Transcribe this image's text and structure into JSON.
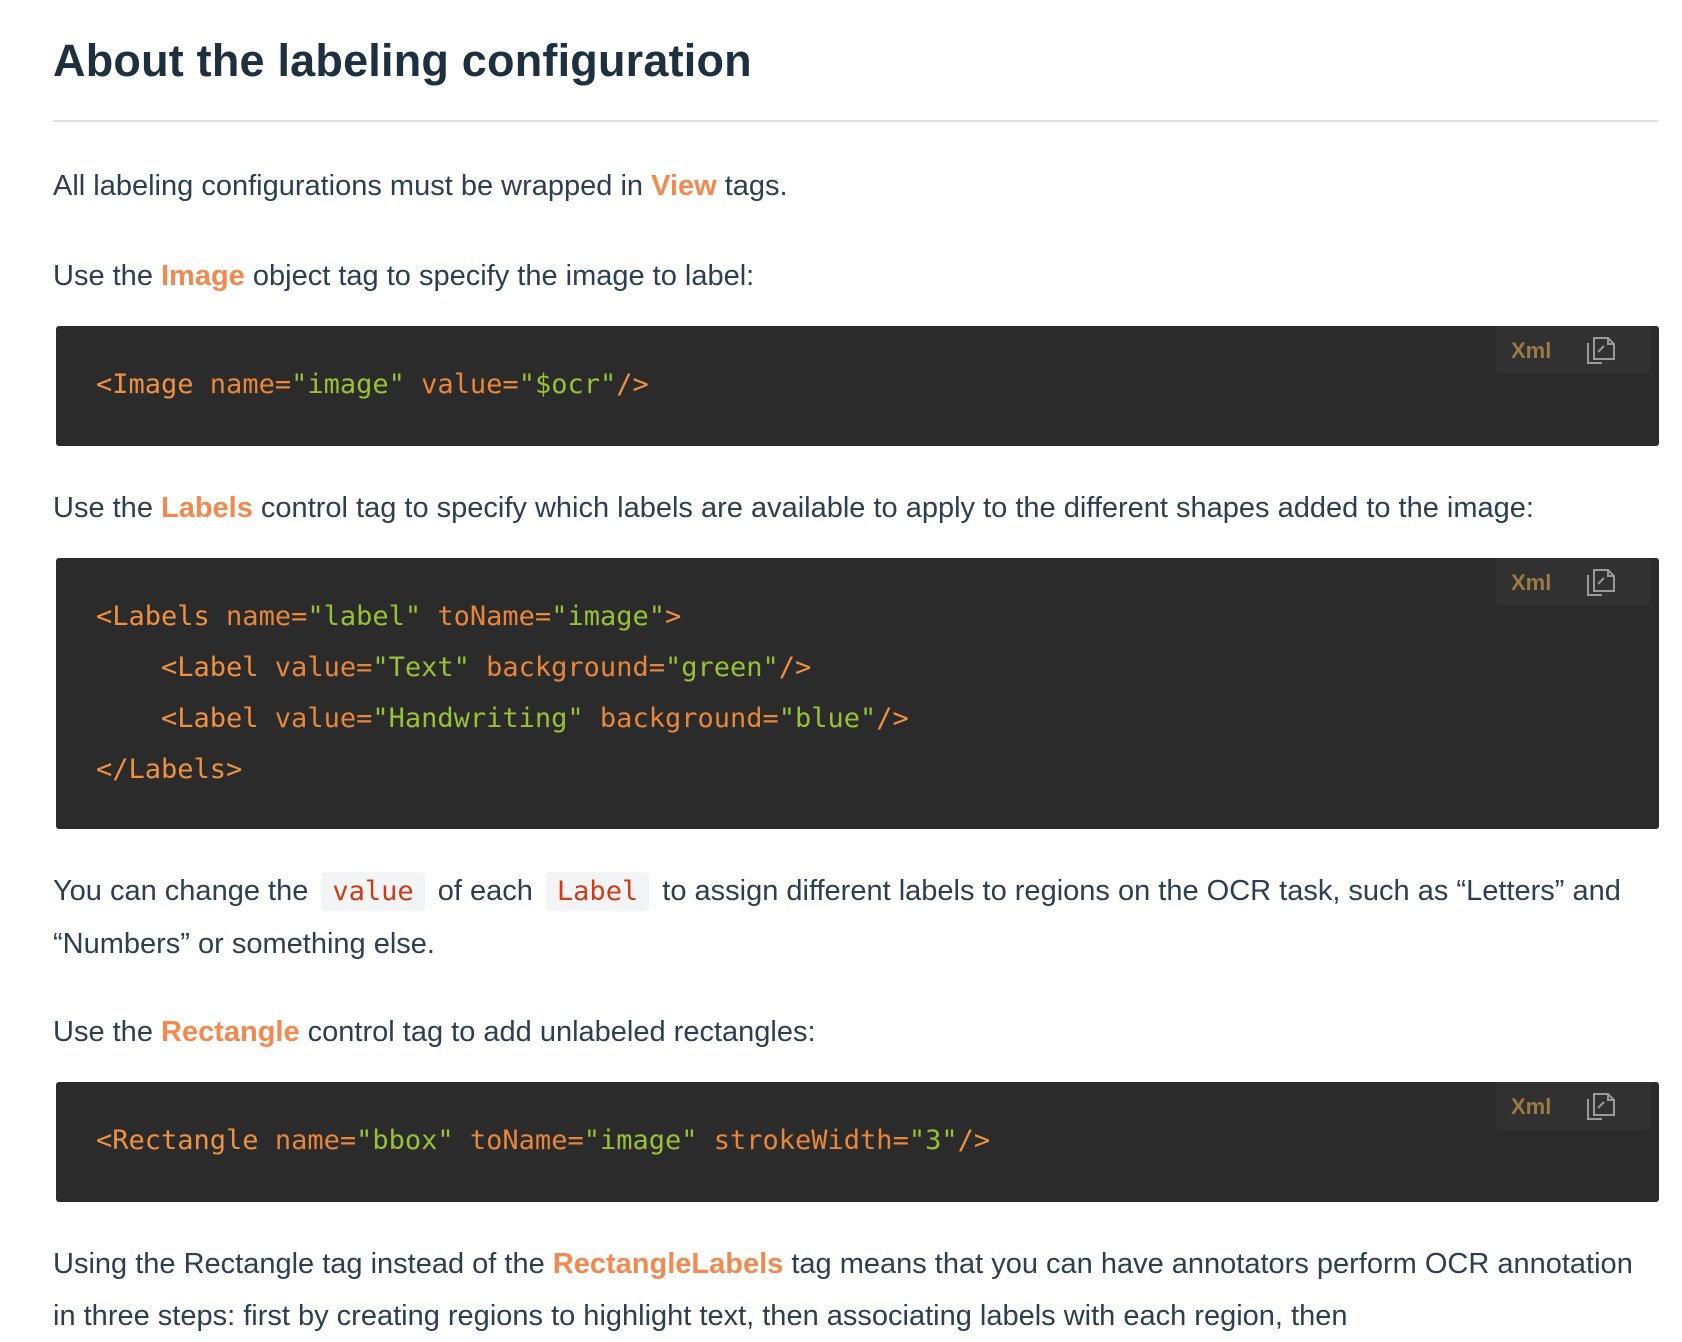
{
  "heading": "About the labeling configuration",
  "para1": {
    "before": "All labeling configurations must be wrapped in ",
    "tag": "View",
    "after": " tags."
  },
  "para2": {
    "before": "Use the ",
    "tag": "Image",
    "after": " object tag to specify the image to label:"
  },
  "code_lang": "Xml",
  "code1": {
    "l1": {
      "open": "<Image",
      "attr1": " name=",
      "val1": "\"image\"",
      "attr2": " value=",
      "val2": "\"$ocr\"",
      "close": "/>"
    }
  },
  "para3": {
    "before": "Use the ",
    "tag": "Labels",
    "after": " control tag to specify which labels are available to apply to the different shapes added to the image:"
  },
  "code2": {
    "l1": {
      "open": "<Labels",
      "attr1": " name=",
      "val1": "\"label\"",
      "attr2": " toName=",
      "val2": "\"image\"",
      "close": ">"
    },
    "l2": {
      "open": "<Label",
      "attr1": " value=",
      "val1": "\"Text\"",
      "attr2": " background=",
      "val2": "\"green\"",
      "close": "/>"
    },
    "l3": {
      "open": "<Label",
      "attr1": " value=",
      "val1": "\"Handwriting\"",
      "attr2": " background=",
      "val2": "\"blue\"",
      "close": "/>"
    },
    "l4": {
      "close": "</Labels>"
    }
  },
  "para4": {
    "before": "You can change the ",
    "code1": "value",
    "middle": " of each ",
    "code2": "Label",
    "after": " to assign different labels to regions on the OCR task, such as “Letters” and “Numbers” or something else."
  },
  "para5": {
    "before": "Use the ",
    "tag": "Rectangle",
    "after": " control tag to add unlabeled rectangles:"
  },
  "code3": {
    "l1": {
      "open": "<Rectangle",
      "attr1": " name=",
      "val1": "\"bbox\"",
      "attr2": " toName=",
      "val2": "\"image\"",
      "attr3": " strokeWidth=",
      "val3": "\"3\"",
      "close": "/>"
    }
  },
  "para6": {
    "before": "Using the Rectangle tag instead of the ",
    "tag": "RectangleLabels",
    "after": " tag means that you can have annotators perform OCR annotation in three steps: first by creating regions to highlight text, then associating labels with each region, then"
  },
  "icons": {
    "copy": "copy-icon"
  },
  "colors": {
    "link": "#f4894f",
    "code_bg": "#2b2b2b",
    "code_tag": "#f0913f",
    "code_string": "#9ac134",
    "inline_code": "#d03b17",
    "heading": "#1e2f3e",
    "text": "#2c3e50"
  }
}
